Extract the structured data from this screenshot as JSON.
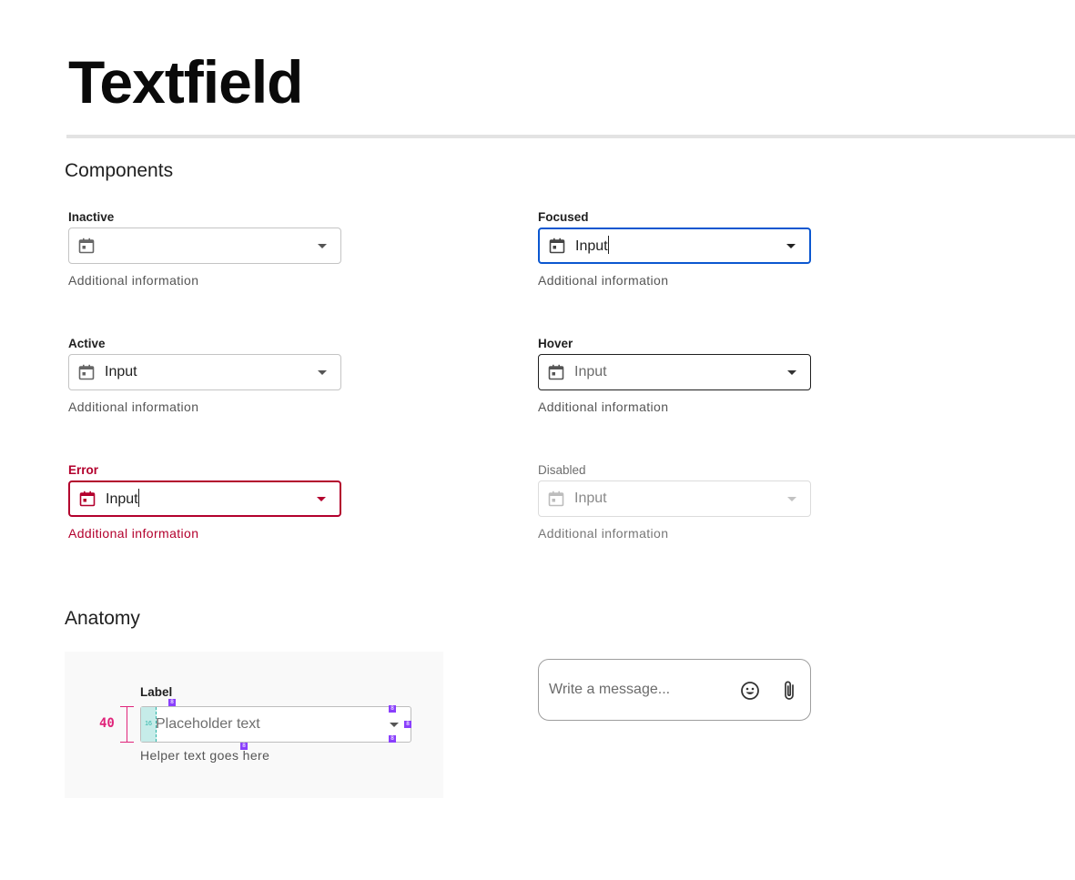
{
  "page": {
    "title": "Textfield"
  },
  "sections": {
    "components": "Components",
    "anatomy": "Anatomy"
  },
  "fields": {
    "inactive": {
      "label": "Inactive",
      "value": "",
      "helper": "Additional information"
    },
    "focused": {
      "label": "Focused",
      "value": "Input",
      "helper": "Additional information"
    },
    "active": {
      "label": "Active",
      "value": "Input",
      "helper": "Additional information"
    },
    "hover": {
      "label": "Hover",
      "value": "Input",
      "helper": "Additional information"
    },
    "error": {
      "label": "Error",
      "value": "Input",
      "helper": "Additional information"
    },
    "disabled": {
      "label": "Disabled",
      "value": "Input",
      "helper": "Additional information"
    }
  },
  "anatomy": {
    "label": "Label",
    "placeholder": "Placeholder text",
    "helper": "Helper text goes here",
    "height_value": "40",
    "padding_value": "16",
    "spacing_value": "8"
  },
  "message": {
    "placeholder": "Write a message..."
  },
  "icons": [
    "calendar-icon",
    "caret-down-icon",
    "emoji-icon",
    "attach-icon"
  ],
  "colors": {
    "focus": "#0b57d0",
    "error": "#b3002d",
    "spec_magenta": "#e0247a",
    "spec_purple": "#8a3ffc",
    "spec_teal": "#2bb3a6"
  }
}
